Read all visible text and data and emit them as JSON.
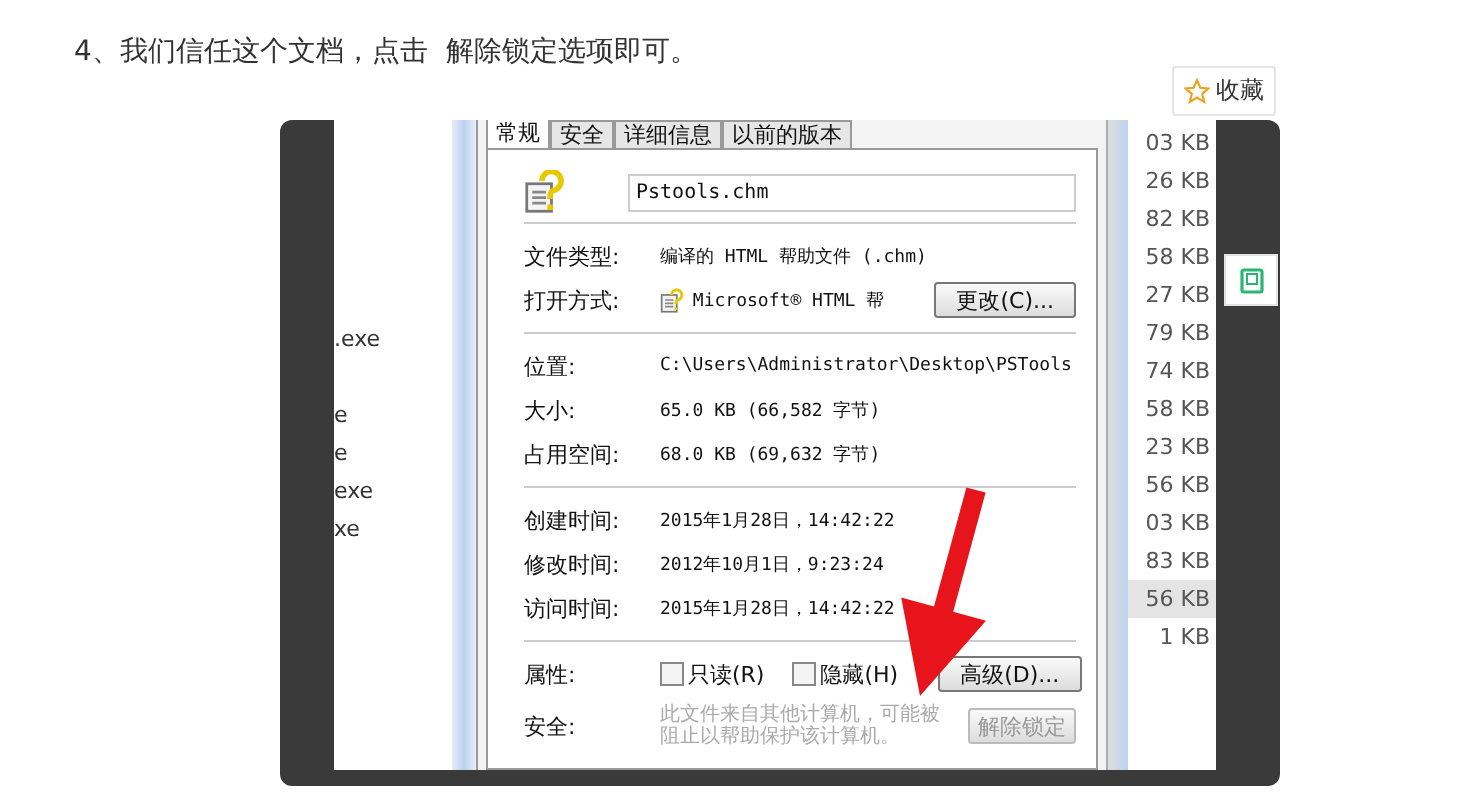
{
  "heading": "4、我们信任这个文档，点击  解除锁定选项即可。",
  "collect_button": {
    "label": "收藏"
  },
  "screenshot": {
    "left_list": [
      ".exe",
      "e",
      "e",
      "exe",
      "xe"
    ],
    "dialog": {
      "tabs": [
        {
          "label": "常规",
          "selected": true
        },
        {
          "label": "安全",
          "selected": false
        },
        {
          "label": "详细信息",
          "selected": false
        },
        {
          "label": "以前的版本",
          "selected": false
        }
      ],
      "file_name": "Pstools.chm",
      "groups": [
        [
          {
            "kind": "text",
            "label": "文件类型:",
            "value": "编译的 HTML 帮助文件 (.chm)"
          },
          {
            "kind": "app",
            "label": "打开方式:",
            "value": "Microsoft® HTML 帮",
            "button": "更改(C)..."
          }
        ],
        [
          {
            "kind": "text",
            "label": "位置:",
            "value": "C:\\Users\\Administrator\\Desktop\\PSTools"
          },
          {
            "kind": "text",
            "label": "大小:",
            "value": "65.0 KB (66,582 字节)"
          },
          {
            "kind": "text",
            "label": "占用空间:",
            "value": "68.0 KB (69,632 字节)"
          }
        ],
        [
          {
            "kind": "text",
            "label": "创建时间:",
            "value": "2015年1月28日，14:42:22"
          },
          {
            "kind": "text",
            "label": "修改时间:",
            "value": "2012年10月1日，9:23:24"
          },
          {
            "kind": "text",
            "label": "访问时间:",
            "value": "2015年1月28日，14:42:22"
          }
        ],
        [
          {
            "kind": "attributes",
            "label": "属性:",
            "checkboxes": [
              {
                "label": "只读(R)",
                "checked": false
              },
              {
                "label": "隐藏(H)",
                "checked": false
              }
            ],
            "button": "高级(D)..."
          },
          {
            "kind": "security",
            "label": "安全:",
            "value": "此文件来自其他计算机，可能被阻止以帮助保护该计算机。",
            "button": "解除锁定"
          }
        ]
      ]
    },
    "size_list": [
      {
        "text": "03 KB",
        "selected": false
      },
      {
        "text": "26 KB",
        "selected": false
      },
      {
        "text": "82 KB",
        "selected": false
      },
      {
        "text": "58 KB",
        "selected": false
      },
      {
        "text": "27 KB",
        "selected": false
      },
      {
        "text": "79 KB",
        "selected": false
      },
      {
        "text": "74 KB",
        "selected": false
      },
      {
        "text": "58 KB",
        "selected": false
      },
      {
        "text": "23 KB",
        "selected": false
      },
      {
        "text": "56 KB",
        "selected": false
      },
      {
        "text": "03 KB",
        "selected": false
      },
      {
        "text": "83 KB",
        "selected": false
      },
      {
        "text": "56 KB",
        "selected": true
      },
      {
        "text": "1 KB",
        "selected": false
      }
    ]
  }
}
